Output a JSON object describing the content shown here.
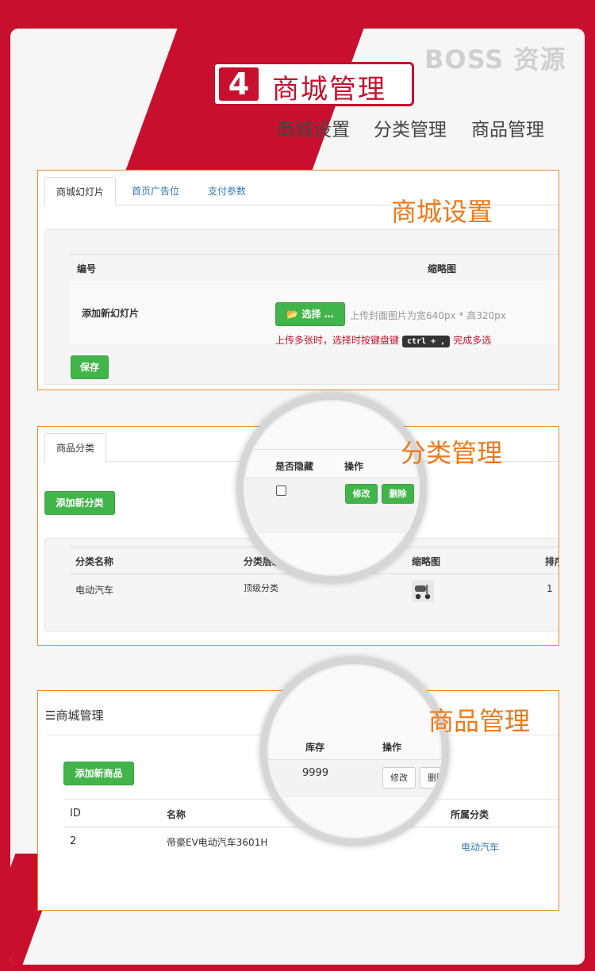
{
  "brand": "BOSS 资源",
  "hero": {
    "number": "4",
    "title": "商城管理",
    "subtitles": [
      "商城设置",
      "分类管理",
      "商品管理"
    ]
  },
  "section1": {
    "label": "商城设置",
    "tabs": [
      "商城幻灯片",
      "首页广告位",
      "支付参数"
    ],
    "headers": {
      "id": "编号",
      "thumb": "缩略图"
    },
    "row_label": "添加新幻灯片",
    "choose_button": "选择 …",
    "hint": "上传封面图片为宽640px * 高320px",
    "warn_before": "上传多张时，选择时按键盘键",
    "kbd": "ctrl + ,",
    "warn_after": "完成多选",
    "save_button": "保存"
  },
  "section2": {
    "label": "分类管理",
    "tab": "商品分类",
    "add_button": "添加新分类",
    "headers": {
      "name": "分类名称",
      "level": "分类层级",
      "thumb": "缩略图",
      "sort": "排序"
    },
    "row": {
      "name": "电动汽车",
      "level": "顶级分类",
      "sort": "1"
    },
    "magnifier": {
      "hidden_header": "是否隐藏",
      "op_header": "操作",
      "edit": "修改",
      "delete": "删除"
    }
  },
  "section3": {
    "label": "商品管理",
    "title": "商城管理",
    "add_button": "添加新商品",
    "headers": {
      "id": "ID",
      "name": "名称",
      "category": "所属分类"
    },
    "row": {
      "id": "2",
      "name": "帝豪EV电动汽车3601H",
      "category": "电动汽车"
    },
    "magnifier": {
      "stock_header": "库存",
      "op_header": "操作",
      "stock": "9999",
      "edit": "修改",
      "delete": "删除"
    }
  },
  "colors": {
    "brand_red": "#c8102e",
    "accent_orange": "#ee7a1a",
    "button_green": "#41b549"
  }
}
